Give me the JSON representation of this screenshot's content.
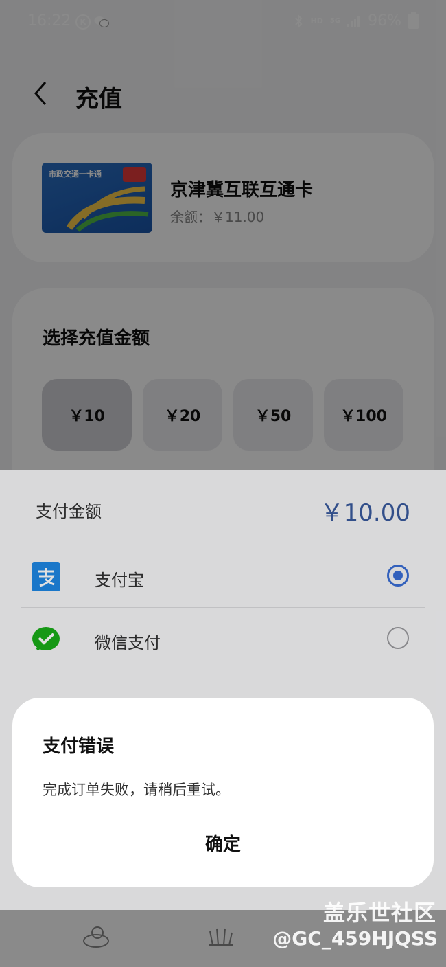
{
  "status_bar": {
    "time": "16:22",
    "k_badge": "K",
    "hd": "HD",
    "net": "5G",
    "battery": "96%"
  },
  "header": {
    "title": "充值"
  },
  "card": {
    "name": "京津冀互联互通卡",
    "balance": "余额：￥11.00",
    "thumb_text": "市政交通一卡通"
  },
  "amount_section": {
    "title": "选择充值金额",
    "options": [
      "￥10",
      "￥20",
      "￥50",
      "￥100"
    ],
    "selected_index": 0
  },
  "payment_sheet": {
    "label": "支付金额",
    "amount": "￥10.00",
    "methods": [
      {
        "label": "支付宝",
        "icon": "alipay-icon",
        "selected": true
      },
      {
        "label": "微信支付",
        "icon": "wechat-pay-icon",
        "selected": false
      }
    ]
  },
  "dialog": {
    "title": "支付错误",
    "message": "完成订单失败，请稍后重试。",
    "confirm": "确定"
  },
  "watermark": {
    "site": "盖乐世社区",
    "user": "@GC_459HJQSS"
  },
  "colors": {
    "accent": "#3b6fd6",
    "amount_text": "#3a5a9e",
    "alipay": "#1e88e5",
    "wechat": "#1aad19"
  }
}
